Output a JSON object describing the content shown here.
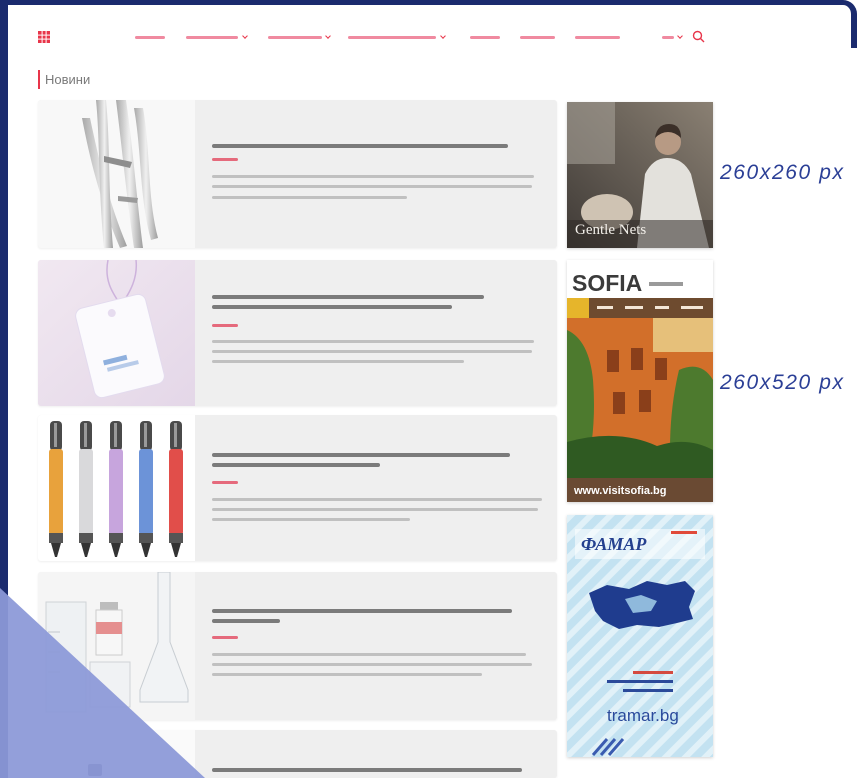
{
  "colors": {
    "accent": "#e8354a",
    "frame": "#1b2b6e",
    "annotation": "#2b3f96",
    "card_background": "#efefef",
    "overlay": "#8c99d8"
  },
  "header": {
    "logo_icon": "grid-icon",
    "dropdown_icon": "chevron-down-icon",
    "search_icon": "search-icon"
  },
  "news": {
    "title": "Новини"
  },
  "ads": [
    {
      "headline": "Gentle Nets"
    },
    {
      "brand": "SOFIA",
      "url": "www.visitsofia.bg"
    },
    {
      "brand": "ФАМАР",
      "url": "tramar.bg"
    }
  ],
  "annotations": [
    "260x260 px",
    "260x520 px"
  ]
}
